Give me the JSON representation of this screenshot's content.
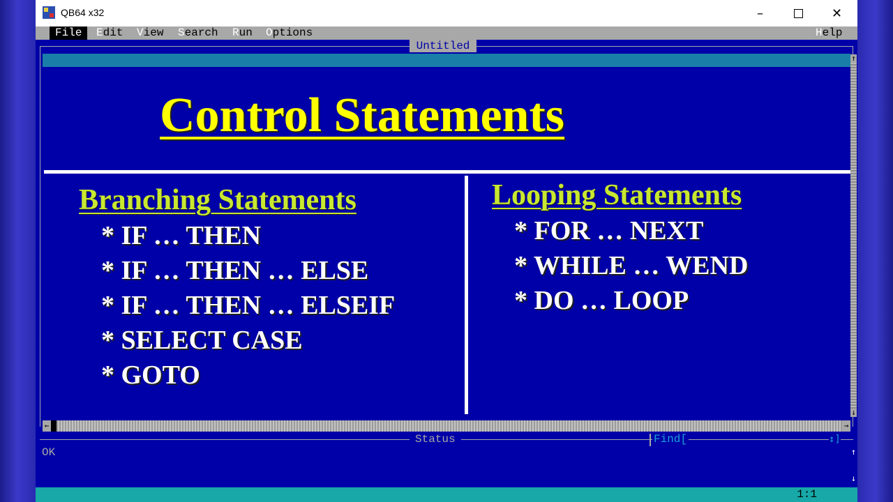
{
  "window": {
    "title": "QB64 x32",
    "icon": "qb64-app-icon"
  },
  "window_controls": {
    "minimize": "–",
    "maximize": "",
    "close": "✕"
  },
  "menu": {
    "file": {
      "hotkey": "F",
      "rest": "ile"
    },
    "edit": {
      "hotkey": "E",
      "rest": "dit"
    },
    "view": {
      "hotkey": "V",
      "rest": "iew"
    },
    "search": {
      "hotkey": "S",
      "rest": "earch"
    },
    "run": {
      "hotkey": "R",
      "rest": "un"
    },
    "options": {
      "hotkey": "O",
      "rest": "ptions"
    },
    "help": {
      "hotkey": "H",
      "rest": "elp"
    }
  },
  "editor": {
    "doc_title": "Untitled"
  },
  "slide": {
    "title": "Control Statements",
    "left_heading": "Branching Statements",
    "left_items": [
      "* IF … THEN",
      "* IF … THEN … ELSE",
      "* IF … THEN … ELSEIF",
      "* SELECT CASE",
      "* GOTO"
    ],
    "right_heading": "Looping Statements",
    "right_items": [
      "* FOR … NEXT",
      "* WHILE … WEND",
      "* DO … LOOP"
    ]
  },
  "scroll_glyphs": {
    "up": "↑",
    "down": "↓",
    "left": "←",
    "right": "→",
    "updown": "↕"
  },
  "status": {
    "label": "Status",
    "find_label": "Find[",
    "find_arrows": "↕]",
    "message": "OK",
    "cursor": "1:1"
  },
  "colors": {
    "editor_bg": "#0000a8",
    "title_yellow": "#ffff00",
    "heading_green": "#c8e830",
    "accent_teal": "#18a8a8",
    "menu_gray": "#a8a8a8"
  }
}
